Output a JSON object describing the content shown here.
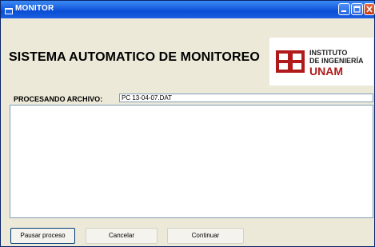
{
  "window": {
    "title": "MONITOR"
  },
  "header": {
    "title": "SISTEMA AUTOMATICO DE MONITOREO"
  },
  "logo": {
    "line1": "INSTITUTO",
    "line2": "DE INGENIERÍA",
    "line3": "UNAM",
    "color": "#b01a1a"
  },
  "processing": {
    "label": "PROCESANDO ARCHIVO:",
    "file_value": "PC 13-04-07.DAT"
  },
  "log": {
    "content": ""
  },
  "buttons": {
    "pause": "Pausar proceso",
    "cancel": "Cancelar",
    "continue": "Continuar"
  }
}
